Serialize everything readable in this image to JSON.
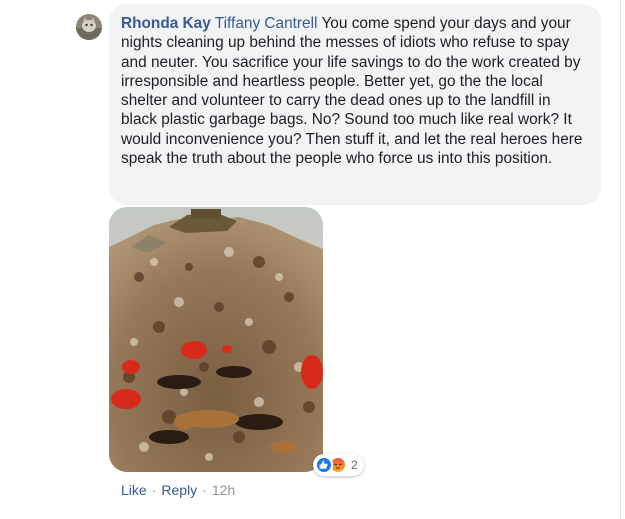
{
  "comment": {
    "author": "Rhonda Kay",
    "tagged_user": "Tiffany Cantrell",
    "text": " You come spend your days and your nights cleaning up behind the messes of idiots who refuse to spay and neuter. You sacrifice your life savings to do the work created by irresponsible and heartless people. Better yet, go the the local shelter and volunteer to carry the dead ones up to the landfill in black plastic garbage bags. No? Sound too much like real work? It would inconvenience you? Then stuff it, and let the real heroes here speak the truth about the people who force us into this position.",
    "reactions": {
      "icons": [
        "like-icon",
        "angry-icon"
      ],
      "count": "2"
    },
    "actions": {
      "like": "Like",
      "reply": "Reply",
      "separator": "·",
      "time": "12h"
    }
  },
  "colors": {
    "link": "#385898",
    "bubble_bg": "#f2f3f5",
    "meta": "#90949c",
    "like_blue": "#1877f2"
  }
}
